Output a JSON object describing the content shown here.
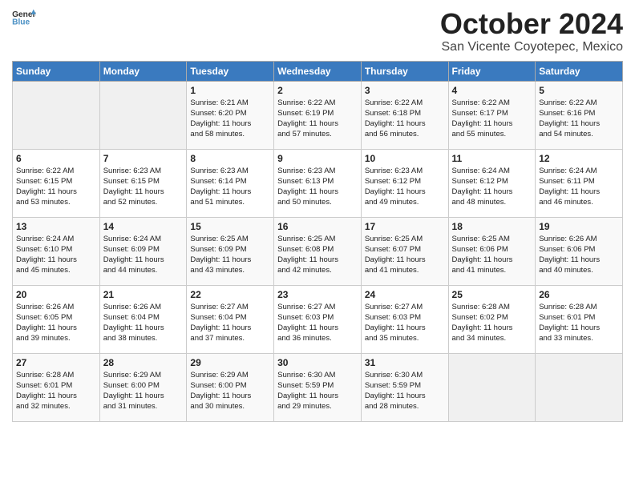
{
  "logo": {
    "general": "General",
    "blue": "Blue"
  },
  "header": {
    "month": "October 2024",
    "location": "San Vicente Coyotepec, Mexico"
  },
  "weekdays": [
    "Sunday",
    "Monday",
    "Tuesday",
    "Wednesday",
    "Thursday",
    "Friday",
    "Saturday"
  ],
  "weeks": [
    [
      {
        "day": "",
        "info": ""
      },
      {
        "day": "",
        "info": ""
      },
      {
        "day": "1",
        "info": "Sunrise: 6:21 AM\nSunset: 6:20 PM\nDaylight: 11 hours\nand 58 minutes."
      },
      {
        "day": "2",
        "info": "Sunrise: 6:22 AM\nSunset: 6:19 PM\nDaylight: 11 hours\nand 57 minutes."
      },
      {
        "day": "3",
        "info": "Sunrise: 6:22 AM\nSunset: 6:18 PM\nDaylight: 11 hours\nand 56 minutes."
      },
      {
        "day": "4",
        "info": "Sunrise: 6:22 AM\nSunset: 6:17 PM\nDaylight: 11 hours\nand 55 minutes."
      },
      {
        "day": "5",
        "info": "Sunrise: 6:22 AM\nSunset: 6:16 PM\nDaylight: 11 hours\nand 54 minutes."
      }
    ],
    [
      {
        "day": "6",
        "info": "Sunrise: 6:22 AM\nSunset: 6:15 PM\nDaylight: 11 hours\nand 53 minutes."
      },
      {
        "day": "7",
        "info": "Sunrise: 6:23 AM\nSunset: 6:15 PM\nDaylight: 11 hours\nand 52 minutes."
      },
      {
        "day": "8",
        "info": "Sunrise: 6:23 AM\nSunset: 6:14 PM\nDaylight: 11 hours\nand 51 minutes."
      },
      {
        "day": "9",
        "info": "Sunrise: 6:23 AM\nSunset: 6:13 PM\nDaylight: 11 hours\nand 50 minutes."
      },
      {
        "day": "10",
        "info": "Sunrise: 6:23 AM\nSunset: 6:12 PM\nDaylight: 11 hours\nand 49 minutes."
      },
      {
        "day": "11",
        "info": "Sunrise: 6:24 AM\nSunset: 6:12 PM\nDaylight: 11 hours\nand 48 minutes."
      },
      {
        "day": "12",
        "info": "Sunrise: 6:24 AM\nSunset: 6:11 PM\nDaylight: 11 hours\nand 46 minutes."
      }
    ],
    [
      {
        "day": "13",
        "info": "Sunrise: 6:24 AM\nSunset: 6:10 PM\nDaylight: 11 hours\nand 45 minutes."
      },
      {
        "day": "14",
        "info": "Sunrise: 6:24 AM\nSunset: 6:09 PM\nDaylight: 11 hours\nand 44 minutes."
      },
      {
        "day": "15",
        "info": "Sunrise: 6:25 AM\nSunset: 6:09 PM\nDaylight: 11 hours\nand 43 minutes."
      },
      {
        "day": "16",
        "info": "Sunrise: 6:25 AM\nSunset: 6:08 PM\nDaylight: 11 hours\nand 42 minutes."
      },
      {
        "day": "17",
        "info": "Sunrise: 6:25 AM\nSunset: 6:07 PM\nDaylight: 11 hours\nand 41 minutes."
      },
      {
        "day": "18",
        "info": "Sunrise: 6:25 AM\nSunset: 6:06 PM\nDaylight: 11 hours\nand 41 minutes."
      },
      {
        "day": "19",
        "info": "Sunrise: 6:26 AM\nSunset: 6:06 PM\nDaylight: 11 hours\nand 40 minutes."
      }
    ],
    [
      {
        "day": "20",
        "info": "Sunrise: 6:26 AM\nSunset: 6:05 PM\nDaylight: 11 hours\nand 39 minutes."
      },
      {
        "day": "21",
        "info": "Sunrise: 6:26 AM\nSunset: 6:04 PM\nDaylight: 11 hours\nand 38 minutes."
      },
      {
        "day": "22",
        "info": "Sunrise: 6:27 AM\nSunset: 6:04 PM\nDaylight: 11 hours\nand 37 minutes."
      },
      {
        "day": "23",
        "info": "Sunrise: 6:27 AM\nSunset: 6:03 PM\nDaylight: 11 hours\nand 36 minutes."
      },
      {
        "day": "24",
        "info": "Sunrise: 6:27 AM\nSunset: 6:03 PM\nDaylight: 11 hours\nand 35 minutes."
      },
      {
        "day": "25",
        "info": "Sunrise: 6:28 AM\nSunset: 6:02 PM\nDaylight: 11 hours\nand 34 minutes."
      },
      {
        "day": "26",
        "info": "Sunrise: 6:28 AM\nSunset: 6:01 PM\nDaylight: 11 hours\nand 33 minutes."
      }
    ],
    [
      {
        "day": "27",
        "info": "Sunrise: 6:28 AM\nSunset: 6:01 PM\nDaylight: 11 hours\nand 32 minutes."
      },
      {
        "day": "28",
        "info": "Sunrise: 6:29 AM\nSunset: 6:00 PM\nDaylight: 11 hours\nand 31 minutes."
      },
      {
        "day": "29",
        "info": "Sunrise: 6:29 AM\nSunset: 6:00 PM\nDaylight: 11 hours\nand 30 minutes."
      },
      {
        "day": "30",
        "info": "Sunrise: 6:30 AM\nSunset: 5:59 PM\nDaylight: 11 hours\nand 29 minutes."
      },
      {
        "day": "31",
        "info": "Sunrise: 6:30 AM\nSunset: 5:59 PM\nDaylight: 11 hours\nand 28 minutes."
      },
      {
        "day": "",
        "info": ""
      },
      {
        "day": "",
        "info": ""
      }
    ]
  ]
}
